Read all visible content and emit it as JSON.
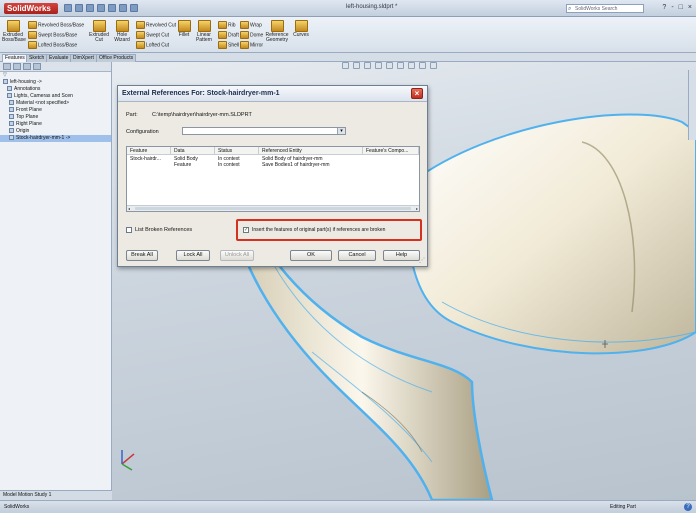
{
  "app": {
    "logo": "SolidWorks",
    "document_title": "left-housing.sldprt *",
    "search_placeholder": "SolidWorks Search",
    "window_controls": [
      "?",
      "-",
      "□",
      "×"
    ]
  },
  "command_manager": {
    "tools": [
      {
        "label": "Extruded Boss/Base",
        "icon": "extrude-boss-icon"
      },
      {
        "label": "Revolved Boss/Base",
        "icon": "revolve-boss-icon"
      },
      {
        "label": "Swept Boss/Base",
        "icon": "sweep-icon"
      },
      {
        "label": "Lofted Boss/Base",
        "icon": "loft-icon"
      },
      {
        "label": "Extruded Cut",
        "icon": "extrude-cut-icon"
      },
      {
        "label": "Hole Wizard",
        "icon": "hole-wizard-icon"
      },
      {
        "label": "Revolved Cut",
        "icon": "revolve-cut-icon"
      },
      {
        "label": "Swept Cut",
        "icon": "swept-cut-icon"
      },
      {
        "label": "Lofted Cut",
        "icon": "lofted-cut-icon"
      },
      {
        "label": "Fillet",
        "icon": "fillet-icon"
      },
      {
        "label": "Linear Pattern",
        "icon": "linear-pattern-icon"
      },
      {
        "label": "Rib",
        "icon": "rib-icon"
      },
      {
        "label": "Draft",
        "icon": "draft-icon"
      },
      {
        "label": "Shell",
        "icon": "shell-icon"
      },
      {
        "label": "Wrap",
        "icon": "wrap-icon"
      },
      {
        "label": "Dome",
        "icon": "dome-icon"
      },
      {
        "label": "Mirror",
        "icon": "mirror-icon"
      },
      {
        "label": "Reference Geometry",
        "icon": "ref-geometry-icon"
      },
      {
        "label": "Curves",
        "icon": "curves-icon"
      }
    ],
    "tabs": [
      "Features",
      "Sketch",
      "Evaluate",
      "DimXpert",
      "Office Products"
    ]
  },
  "feature_manager": {
    "filter": "▽",
    "tree": [
      {
        "label": "left-housing ->",
        "icon": "part-icon"
      },
      {
        "label": "Annotations",
        "icon": "annotations-icon"
      },
      {
        "label": "Lights, Cameras and Scen",
        "icon": "lights-icon"
      },
      {
        "label": "Material <not specified>",
        "icon": "material-icon"
      },
      {
        "label": "Front Plane",
        "icon": "plane-icon"
      },
      {
        "label": "Top Plane",
        "icon": "plane-icon"
      },
      {
        "label": "Right Plane",
        "icon": "plane-icon"
      },
      {
        "label": "Origin",
        "icon": "origin-icon"
      },
      {
        "label": "Stock-hairdryer-mm-1 ->",
        "icon": "stock-icon",
        "selected": true
      }
    ],
    "bottom_tabs": "Model  Motion Study 1"
  },
  "dialog": {
    "title": "External References For: Stock-hairdryer-mm-1",
    "part_label": "Part:",
    "part_value": "C:\\temp\\hairdryer\\hairdryer-mm.SLDPRT",
    "configuration_label": "Configuration",
    "configuration_value": "",
    "columns": [
      "Feature",
      "Data",
      "Status",
      "Referenced Entity",
      "Feature's Compo..."
    ],
    "rows": [
      {
        "feature": "Stock-hairdr...",
        "data": "Solid Body",
        "status": "In context",
        "entity": "Solid Body of hairdryer-mm",
        "component": ""
      },
      {
        "feature": "",
        "data": "Feature",
        "status": "In context",
        "entity": "Save Bodies1 of hairdryer-mm",
        "component": ""
      }
    ],
    "list_broken_label": "List Broken References",
    "list_broken_checked": false,
    "insert_features_label": "Insert the features of original part(s) if references are broken",
    "insert_features_checked": true,
    "buttons": {
      "break_all": "Break All",
      "lock_all": "Lock All",
      "unlock_all": "Unlock All",
      "ok": "OK",
      "cancel": "Cancel",
      "help": "Help"
    }
  },
  "status_bar": {
    "left": "SolidWorks",
    "right": "Editing Part",
    "help": "?"
  },
  "colors": {
    "highlight_border": "#d6311f",
    "selection": "#9fc0ea",
    "model_glow": "#4fb1ee"
  }
}
